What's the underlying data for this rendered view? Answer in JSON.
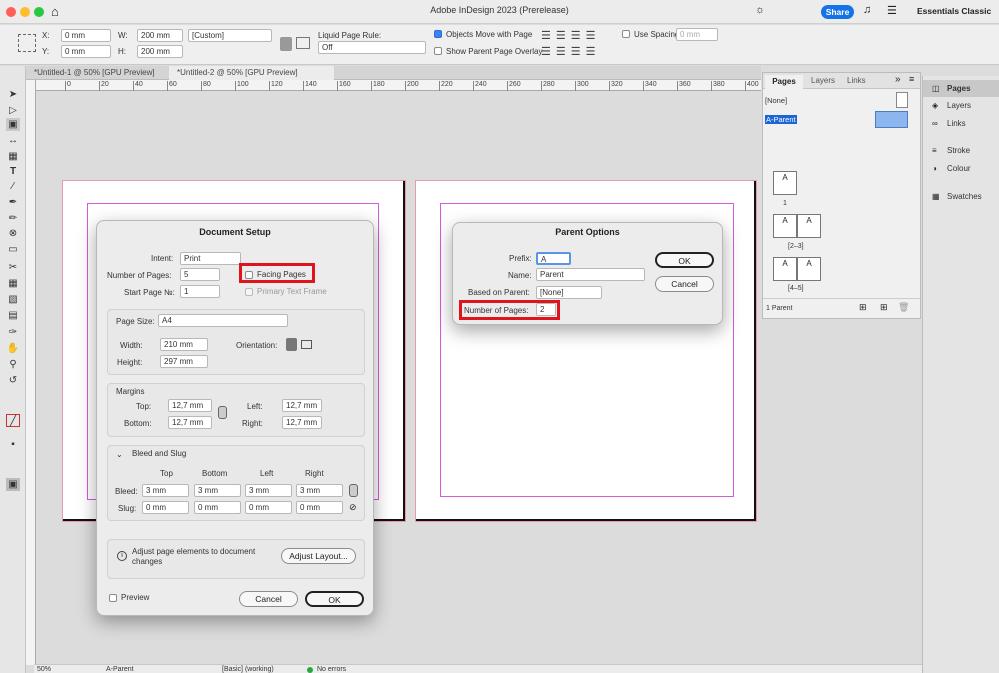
{
  "app": {
    "title": "Adobe InDesign 2023 (Prerelease)",
    "share": "Share",
    "workspace": "Essentials Classic"
  },
  "control": {
    "x_label": "X:",
    "x_value": "0 mm",
    "y_label": "Y:",
    "y_value": "0 mm",
    "w_label": "W:",
    "w_value": "200 mm",
    "h_label": "H:",
    "h_value": "200 mm",
    "custom": "[Custom]",
    "liquid_label": "Liquid Page Rule:",
    "liquid_value": "Off",
    "objects_move": "Objects Move with Page",
    "show_overlay": "Show Parent Page Overlay",
    "use_spacing": "Use Spacing",
    "spacing_value": "0 mm"
  },
  "tabs": [
    {
      "label": "*Untitled-1 @ 50% [GPU Preview]"
    },
    {
      "label": "*Untitled-2 @ 50% [GPU Preview]"
    }
  ],
  "ruler_h": [
    "0",
    "20",
    "40",
    "60",
    "80",
    "100",
    "120",
    "140",
    "160",
    "180",
    "200",
    "220",
    "240",
    "260",
    "280",
    "300",
    "320",
    "340",
    "360",
    "380",
    "400"
  ],
  "document_setup": {
    "title": "Document Setup",
    "intent_label": "Intent:",
    "intent": "Print",
    "num_pages_label": "Number of Pages:",
    "num_pages": "5",
    "start_page_label": "Start Page №:",
    "start_page": "1",
    "facing_pages": "Facing Pages",
    "primary_text_frame": "Primary Text Frame",
    "page_size_label": "Page Size:",
    "page_size": "A4",
    "width_label": "Width:",
    "width": "210 mm",
    "height_label": "Height:",
    "height": "297 mm",
    "orientation_label": "Orientation:",
    "margins_label": "Margins",
    "top_label": "Top:",
    "top": "12,7 mm",
    "bottom_label": "Bottom:",
    "bottom": "12,7 mm",
    "left_label": "Left:",
    "left": "12,7 mm",
    "right_label": "Right:",
    "right": "12,7 mm",
    "bleed_slug_label": "Bleed and Slug",
    "col_top": "Top",
    "col_bottom": "Bottom",
    "col_left": "Left",
    "col_right": "Right",
    "bleed_label": "Bleed:",
    "bleed": [
      "3 mm",
      "3 mm",
      "3 mm",
      "3 mm"
    ],
    "slug_label": "Slug:",
    "slug": [
      "0 mm",
      "0 mm",
      "0 mm",
      "0 mm"
    ],
    "info": "Adjust page elements to document changes",
    "adjust_layout": "Adjust Layout...",
    "preview": "Preview",
    "cancel": "Cancel",
    "ok": "OK"
  },
  "parent_options": {
    "title": "Parent Options",
    "prefix_label": "Prefix:",
    "prefix": "A",
    "name_label": "Name:",
    "name": "Parent",
    "based_on_label": "Based on Parent:",
    "based_on": "[None]",
    "num_pages_label": "Number of Pages:",
    "num_pages": "2",
    "ok": "OK",
    "cancel": "Cancel"
  },
  "pages_panel": {
    "tabs": [
      "Pages",
      "Layers",
      "Links"
    ],
    "none": "[None]",
    "a_parent": "A-Parent",
    "spreads": [
      "1",
      "[2–3]",
      "[4–5]"
    ],
    "footer": "1 Parent"
  },
  "dock": [
    "Pages",
    "Layers",
    "Links",
    "Stroke",
    "Colour",
    "Swatches"
  ],
  "status": {
    "zoom": "50%",
    "parent": "A-Parent",
    "preflight": "[Basic] (working)",
    "errors": "No errors"
  }
}
